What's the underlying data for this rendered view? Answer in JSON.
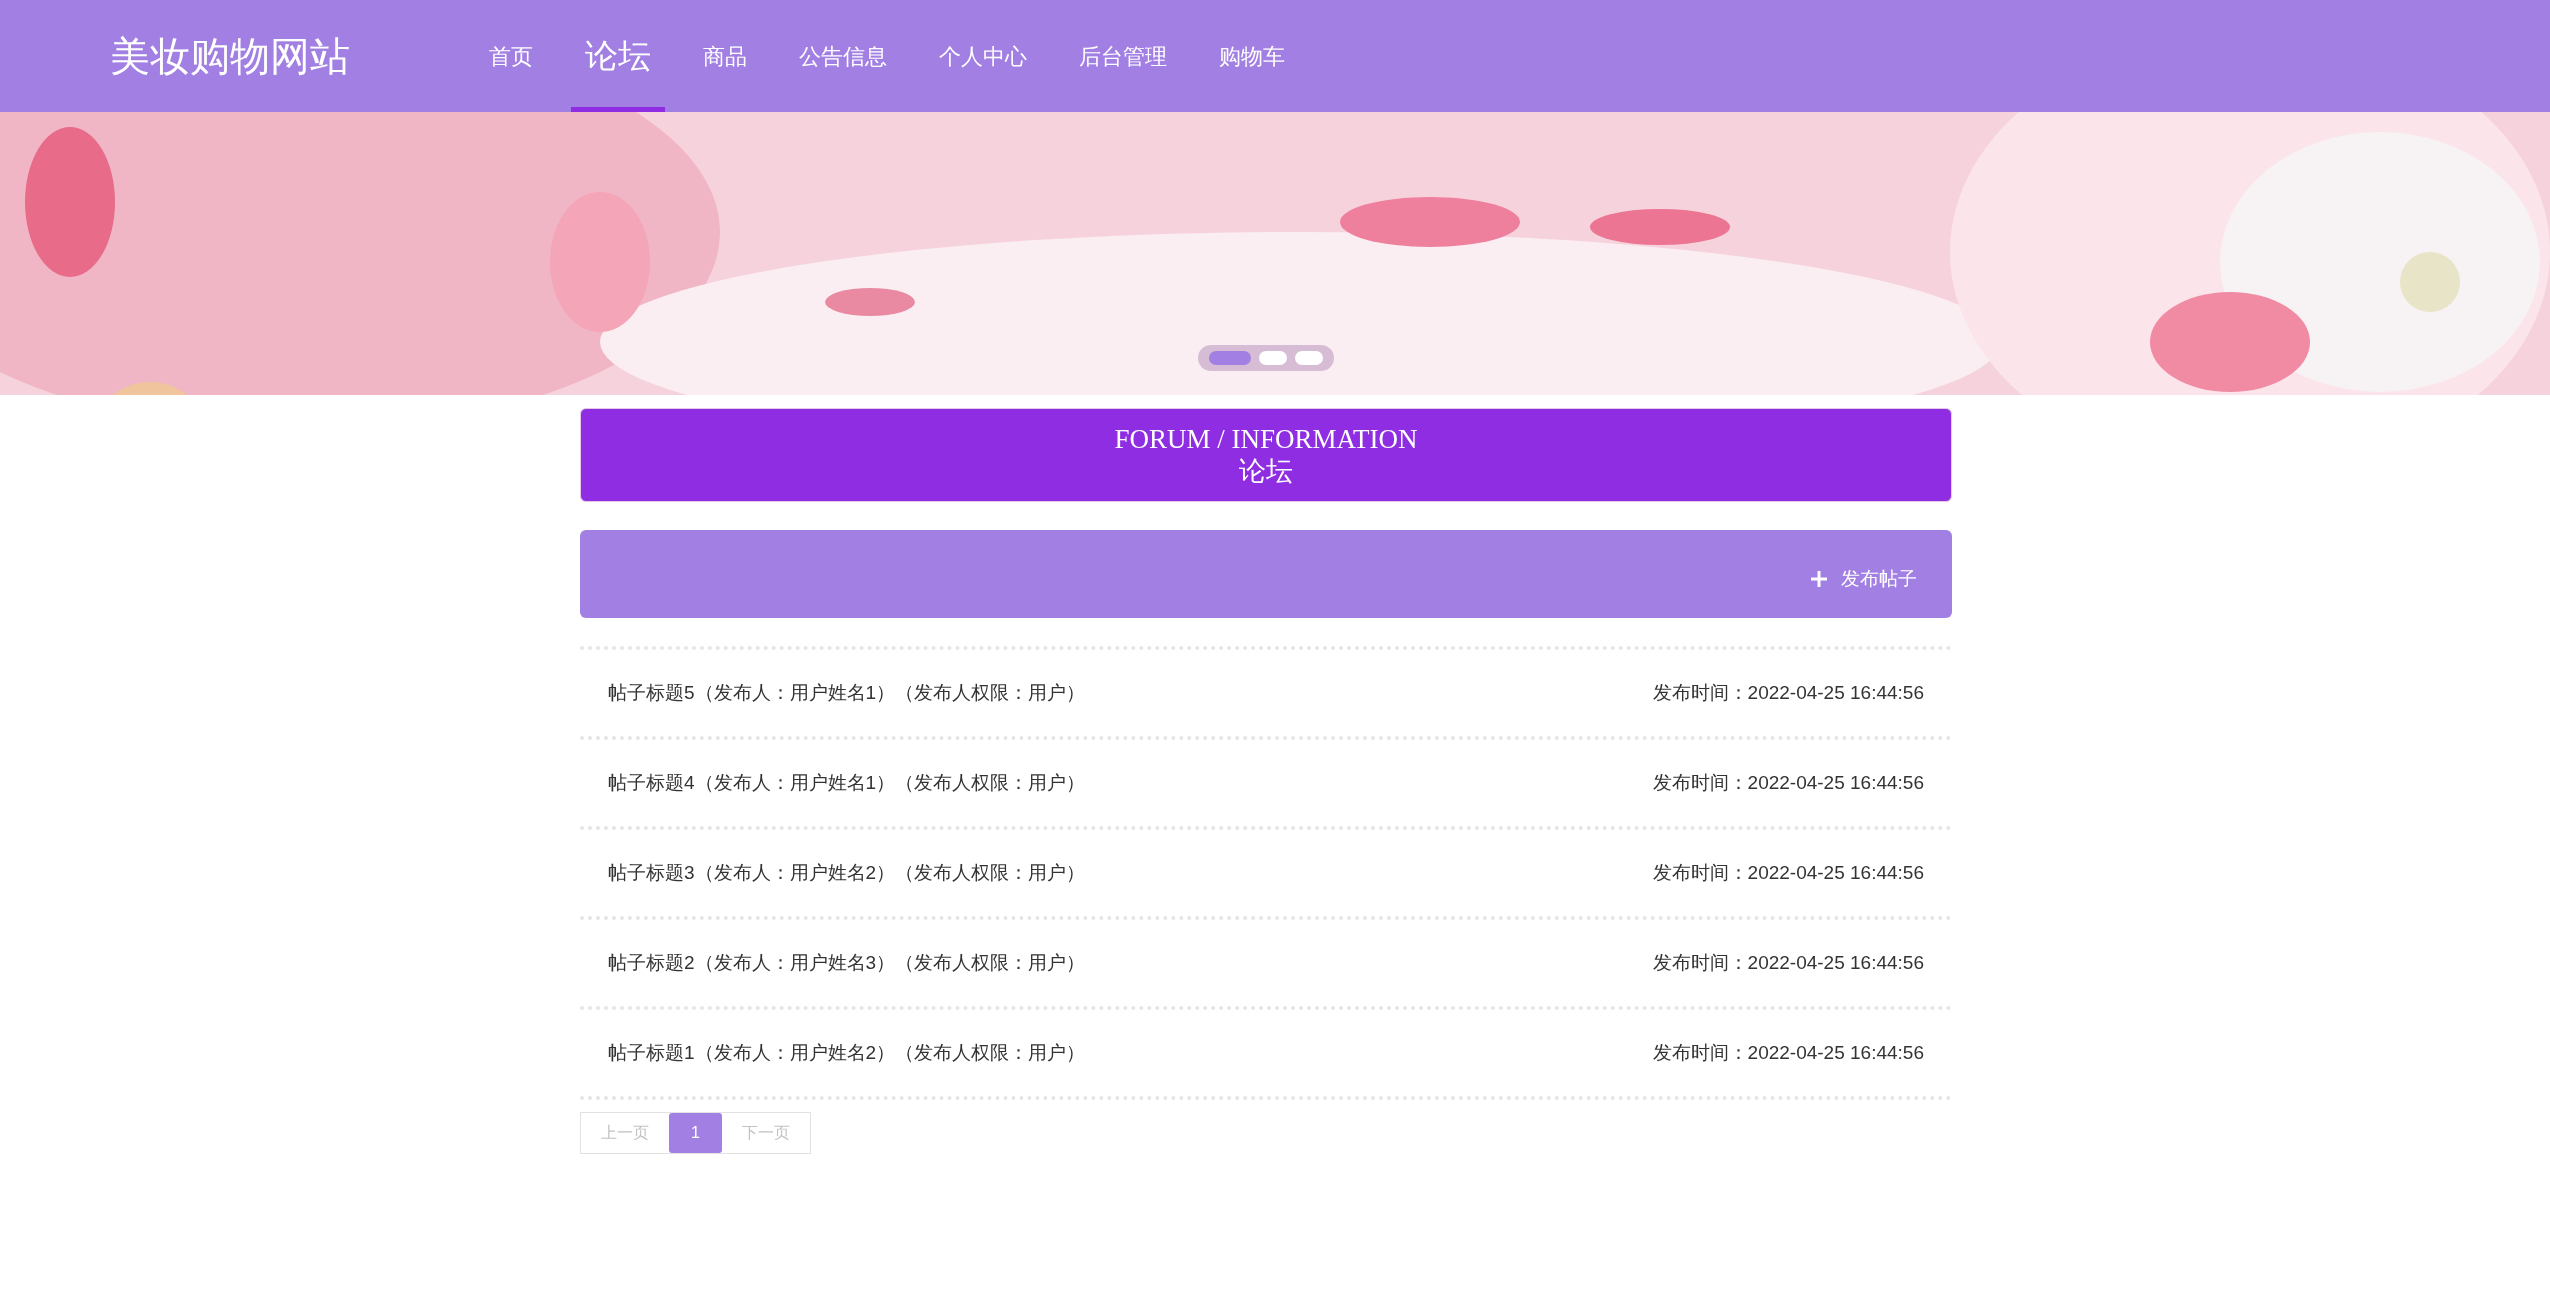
{
  "site_title": "美妆购物网站",
  "nav": [
    {
      "label": "首页",
      "selected": false
    },
    {
      "label": "论坛",
      "selected": true
    },
    {
      "label": "商品",
      "selected": false
    },
    {
      "label": "公告信息",
      "selected": false
    },
    {
      "label": "个人中心",
      "selected": false
    },
    {
      "label": "后台管理",
      "selected": false
    },
    {
      "label": "购物车",
      "selected": false
    }
  ],
  "banner": {
    "slides": [
      {
        "selected": true
      },
      {
        "selected": false
      },
      {
        "selected": false
      }
    ]
  },
  "section_header": {
    "title_en": "FORUM / INFORMATION",
    "title_cn": "论坛"
  },
  "new_post_button": "发布帖子",
  "posts": [
    {
      "title": "帖子标题5（发布人：用户姓名1）（发布人权限：用户）",
      "time": "发布时间：2022-04-25 16:44:56"
    },
    {
      "title": "帖子标题4（发布人：用户姓名1）（发布人权限：用户）",
      "time": "发布时间：2022-04-25 16:44:56"
    },
    {
      "title": "帖子标题3（发布人：用户姓名2）（发布人权限：用户）",
      "time": "发布时间：2022-04-25 16:44:56"
    },
    {
      "title": "帖子标题2（发布人：用户姓名3）（发布人权限：用户）",
      "time": "发布时间：2022-04-25 16:44:56"
    },
    {
      "title": "帖子标题1（发布人：用户姓名2）（发布人权限：用户）",
      "time": "发布时间：2022-04-25 16:44:56"
    }
  ],
  "pagination": [
    {
      "label": "上一页",
      "selected": false
    },
    {
      "label": "1",
      "selected": true
    },
    {
      "label": "下一页",
      "selected": false
    }
  ]
}
